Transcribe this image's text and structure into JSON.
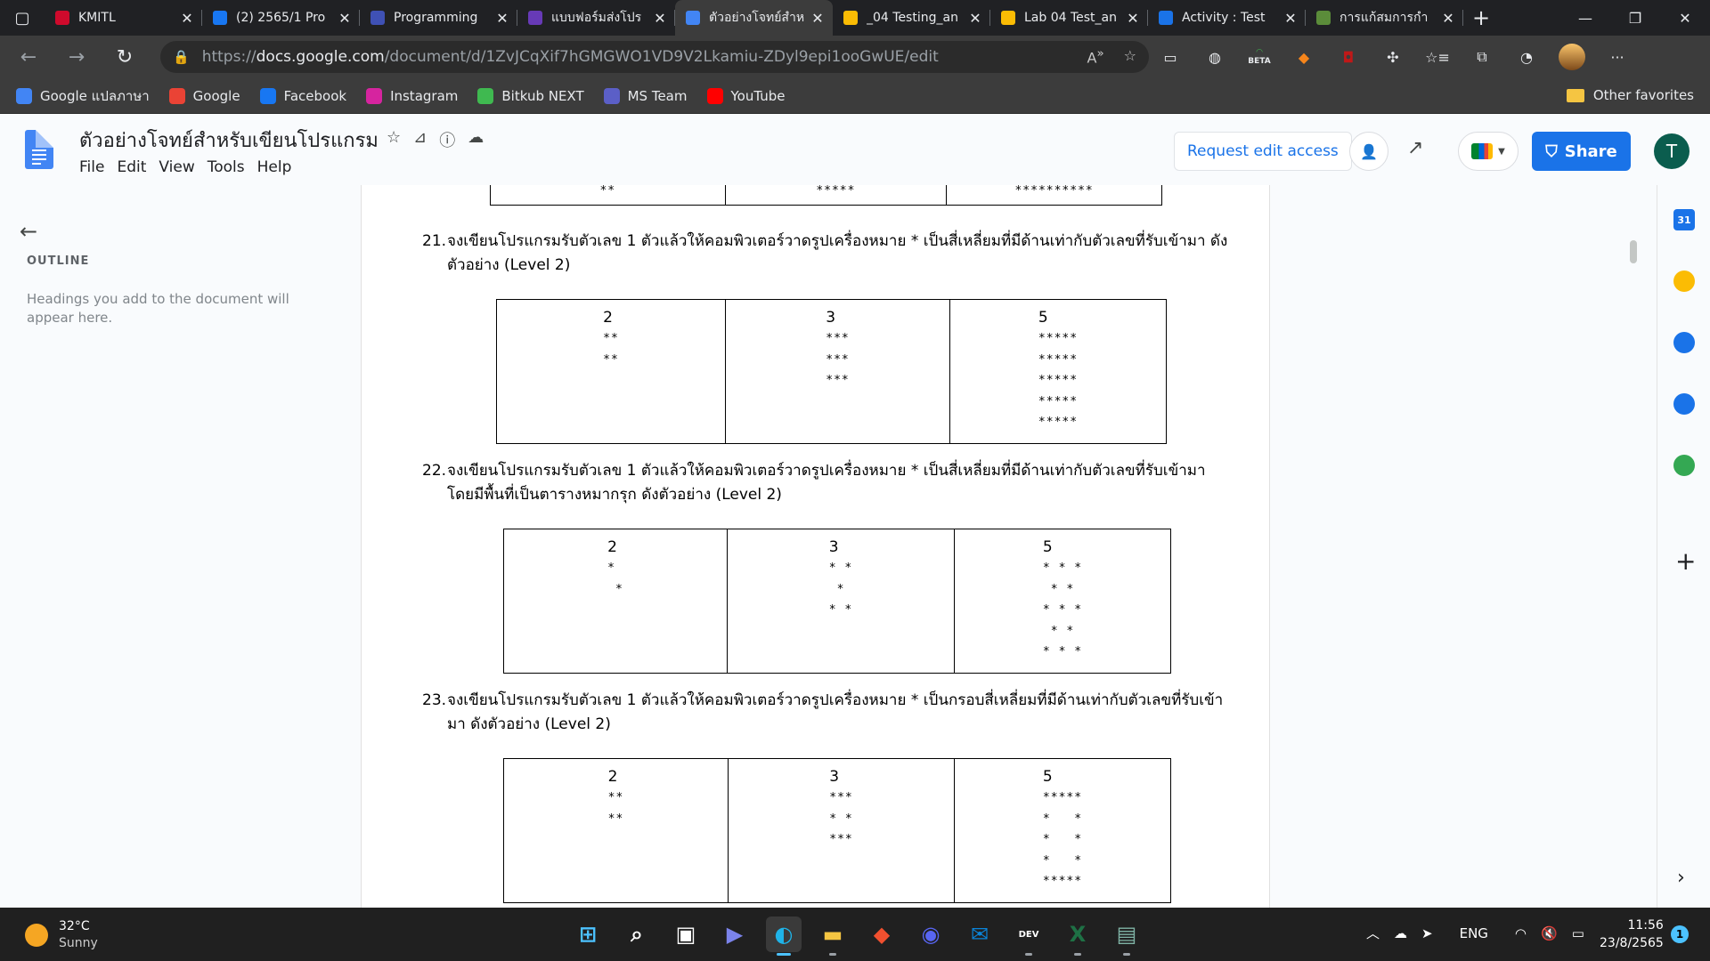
{
  "browser": {
    "tabs": [
      {
        "title": "KMITL",
        "icon": "huawei-icon",
        "color": "#cf0a2c",
        "active": false
      },
      {
        "title": "(2) 2565/1 Pro",
        "icon": "facebook-icon",
        "color": "#1877f2",
        "active": false
      },
      {
        "title": "Programming",
        "icon": "forms-icon",
        "color": "#3f51b5",
        "active": false
      },
      {
        "title": "แบบฟอร์มส่งโปร",
        "icon": "forms-icon",
        "color": "#673ab7",
        "active": false
      },
      {
        "title": "ตัวอย่างโจทย์สำห",
        "icon": "docs-icon",
        "color": "#4285f4",
        "active": true
      },
      {
        "title": "_04 Testing_an",
        "icon": "drive-icon",
        "color": "#fbbc04",
        "active": false
      },
      {
        "title": "Lab 04 Test_an",
        "icon": "drive-icon",
        "color": "#fbbc04",
        "active": false
      },
      {
        "title": "Activity : Test",
        "icon": "classroom-icon",
        "color": "#1a73e8",
        "active": false
      },
      {
        "title": "การแก้สมการกำ",
        "icon": "site-icon",
        "color": "#5b8c3a",
        "active": false
      }
    ],
    "url_prefix": "https://",
    "url_host": "docs.google.com",
    "url_path": "/document/d/1ZvJCqXif7hGMGWO1VD9V2Lkamiu-ZDyl9epi1ooGwUE/edit",
    "beta_label": "BETA",
    "favorites": [
      {
        "label": "Google แปลภาษา",
        "icon": "translate-icon",
        "color": "#4285f4"
      },
      {
        "label": "Google",
        "icon": "google-icon",
        "color": "#ea4335"
      },
      {
        "label": "Facebook",
        "icon": "facebook-icon",
        "color": "#1877f2"
      },
      {
        "label": "Instagram",
        "icon": "instagram-icon",
        "color": "#d6249f"
      },
      {
        "label": "Bitkub NEXT",
        "icon": "bitkub-icon",
        "color": "#3fb950"
      },
      {
        "label": "MS Team",
        "icon": "teams-icon",
        "color": "#5b5fc7"
      },
      {
        "label": "YouTube",
        "icon": "youtube-icon",
        "color": "#ff0000"
      }
    ],
    "other_favorites": "Other favorites"
  },
  "docs": {
    "title": "ตัวอย่างโจทย์สำหรับเขียนโปรแกรม",
    "menus": [
      "File",
      "Edit",
      "View",
      "Tools",
      "Help"
    ],
    "request_edit": "Request edit access",
    "share": "Share",
    "avatar_letter": "T"
  },
  "outline": {
    "title": "OUTLINE",
    "hint": "Headings you add to the document will appear here."
  },
  "document": {
    "partial_row": [
      "**",
      "*****",
      "**********"
    ],
    "questions": [
      {
        "number": "21.",
        "text": "จงเขียนโปรแกรมรับตัวเลข 1 ตัวแล้วให้คอมพิวเตอร์วาดรูปเครื่องหมาย * เป็นสี่เหลี่ยมที่มีด้านเท่ากับตัวเลขที่รับเข้ามา ดังตัวอย่าง (Level 2)",
        "examples": [
          {
            "n": "2",
            "pattern": "**\n**"
          },
          {
            "n": "3",
            "pattern": "***\n***\n***"
          },
          {
            "n": "5",
            "pattern": "*****\n*****\n*****\n*****\n*****"
          }
        ]
      },
      {
        "number": "22.",
        "text": "จงเขียนโปรแกรมรับตัวเลข 1 ตัวแล้วให้คอมพิวเตอร์วาดรูปเครื่องหมาย * เป็นสี่เหลี่ยมที่มีด้านเท่ากับตัวเลขที่รับเข้ามาโดยมีพื้นที่เป็นตารางหมากรุก ดังตัวอย่าง (Level 2)",
        "examples": [
          {
            "n": "2",
            "pattern": "*\n *"
          },
          {
            "n": "3",
            "pattern": "* *\n *\n* *"
          },
          {
            "n": "5",
            "pattern": "* * *\n * *\n* * *\n * *\n* * *"
          }
        ]
      },
      {
        "number": "23.",
        "text": "จงเขียนโปรแกรมรับตัวเลข 1 ตัวแล้วให้คอมพิวเตอร์วาดรูปเครื่องหมาย * เป็นกรอบสี่เหลี่ยมที่มีด้านเท่ากับตัวเลขที่รับเข้ามา ดังตัวอย่าง (Level 2)",
        "examples": [
          {
            "n": "2",
            "pattern": "**\n**"
          },
          {
            "n": "3",
            "pattern": "***\n* *\n***"
          },
          {
            "n": "5",
            "pattern": "*****\n*   *\n*   *\n*   *\n*****"
          }
        ]
      }
    ]
  },
  "sidepanel": [
    {
      "name": "calendar-icon",
      "color": "#1a73e8",
      "label": "31"
    },
    {
      "name": "keep-icon",
      "color": "#fbbc04",
      "label": ""
    },
    {
      "name": "tasks-icon",
      "color": "#1a73e8",
      "label": ""
    },
    {
      "name": "contacts-icon",
      "color": "#1a73e8",
      "label": ""
    },
    {
      "name": "maps-icon",
      "color": "#34a853",
      "label": ""
    }
  ],
  "taskbar": {
    "temperature": "32°C",
    "condition": "Sunny",
    "language": "ENG",
    "time": "11:56",
    "date": "23/8/2565",
    "notifications": "1",
    "apps": [
      {
        "name": "start-icon",
        "color": "#4cc2ff",
        "glyph": "⊞",
        "active": false
      },
      {
        "name": "search-icon",
        "color": "#ffffff",
        "glyph": "⌕",
        "active": false
      },
      {
        "name": "task-view-icon",
        "color": "#ffffff",
        "glyph": "▣",
        "active": false
      },
      {
        "name": "meet-chat-icon",
        "color": "#7b83eb",
        "glyph": "▶",
        "active": false
      },
      {
        "name": "edge-icon",
        "color": "#1fb3e8",
        "glyph": "◐",
        "active": true
      },
      {
        "name": "file-explorer-icon",
        "color": "#f5c542",
        "glyph": "▬",
        "active": true
      },
      {
        "name": "git-icon",
        "color": "#f1502f",
        "glyph": "◆",
        "active": false
      },
      {
        "name": "discord-icon",
        "color": "#5865f2",
        "glyph": "◉",
        "active": false
      },
      {
        "name": "mail-icon",
        "color": "#0a84d9",
        "glyph": "✉",
        "active": false
      },
      {
        "name": "dev-icon",
        "color": "#ffffff",
        "glyph": "DEV",
        "active": true
      },
      {
        "name": "excel-icon",
        "color": "#1e7145",
        "glyph": "X",
        "active": true
      },
      {
        "name": "photos-icon",
        "color": "#7fb3a5",
        "glyph": "▤",
        "active": true
      }
    ]
  }
}
